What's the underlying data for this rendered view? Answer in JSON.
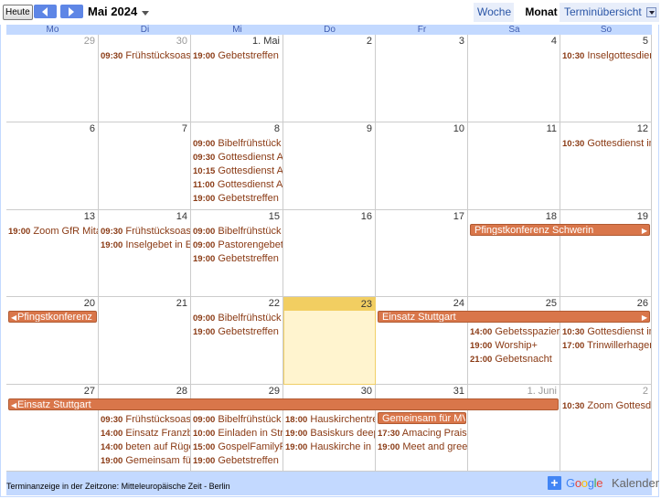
{
  "toolbar": {
    "today_label": "Heute",
    "month_title": "Mai 2024",
    "tabs": {
      "week": "Woche",
      "month": "Monat",
      "agenda": "Terminübersicht"
    }
  },
  "day_names": [
    "Mo",
    "Di",
    "Mi",
    "Do",
    "Fr",
    "Sa",
    "So"
  ],
  "weeks": [
    {
      "days": [
        {
          "date": "29",
          "other": true
        },
        {
          "date": "30",
          "other": true,
          "events": [
            {
              "time": "09:30",
              "title": "Frühstücksoase"
            }
          ]
        },
        {
          "date": "1. Mai",
          "events": [
            {
              "time": "19:00",
              "title": "Gebetstreffen"
            }
          ]
        },
        {
          "date": "2"
        },
        {
          "date": "3"
        },
        {
          "date": "4"
        },
        {
          "date": "5",
          "events": [
            {
              "time": "10:30",
              "title": "Inselgottesdienst"
            }
          ]
        }
      ]
    },
    {
      "days": [
        {
          "date": "6"
        },
        {
          "date": "7"
        },
        {
          "date": "8",
          "events": [
            {
              "time": "09:00",
              "title": "Bibelfrühstück"
            },
            {
              "time": "09:30",
              "title": "Gottesdienst A"
            },
            {
              "time": "10:15",
              "title": "Gottesdienst A"
            },
            {
              "time": "11:00",
              "title": "Gottesdienst A"
            },
            {
              "time": "19:00",
              "title": "Gebetstreffen"
            }
          ]
        },
        {
          "date": "9"
        },
        {
          "date": "10"
        },
        {
          "date": "11"
        },
        {
          "date": "12",
          "events": [
            {
              "time": "10:30",
              "title": "Gottesdienst im"
            }
          ]
        }
      ]
    },
    {
      "days": [
        {
          "date": "13",
          "events": [
            {
              "time": "19:00",
              "title": "Zoom GfR Mitarbeiter"
            }
          ]
        },
        {
          "date": "14",
          "events": [
            {
              "time": "09:30",
              "title": "Frühstücksoase"
            },
            {
              "time": "19:00",
              "title": "Inselgebet in E"
            }
          ]
        },
        {
          "date": "15",
          "events": [
            {
              "time": "09:00",
              "title": "Bibelfrühstück"
            },
            {
              "time": "09:00",
              "title": "Pastorengebet"
            },
            {
              "time": "19:00",
              "title": "Gebetstreffen"
            }
          ]
        },
        {
          "date": "16"
        },
        {
          "date": "17"
        },
        {
          "date": "18"
        },
        {
          "date": "19"
        }
      ],
      "bars": [
        {
          "title": "Pfingstkonferenz Schwerin",
          "start": 5,
          "span": 2,
          "cont_right": true
        }
      ]
    },
    {
      "days": [
        {
          "date": "20"
        },
        {
          "date": "21"
        },
        {
          "date": "22",
          "events": [
            {
              "time": "09:00",
              "title": "Bibelfrühstück"
            },
            {
              "time": "19:00",
              "title": "Gebetstreffen"
            }
          ]
        },
        {
          "date": "23",
          "today": true
        },
        {
          "date": "24"
        },
        {
          "date": "25",
          "events": [
            {
              "time": "14:00",
              "title": "Gebetsspaziergang"
            },
            {
              "time": "19:00",
              "title": "Worship+"
            },
            {
              "time": "21:00",
              "title": "Gebetsnacht"
            }
          ]
        },
        {
          "date": "26",
          "events": [
            {
              "time": "10:30",
              "title": "Gottesdienst im"
            },
            {
              "time": "17:00",
              "title": "Trinwillerhagen"
            }
          ]
        }
      ],
      "bars": [
        {
          "title": "Pfingstkonferenz",
          "start": 0,
          "span": 1,
          "cont_left": true
        },
        {
          "title": "Einsatz Stuttgart",
          "start": 4,
          "span": 3,
          "cont_right": true
        }
      ]
    },
    {
      "days": [
        {
          "date": "27"
        },
        {
          "date": "28",
          "events": [
            {
              "time": "09:30",
              "title": "Frühstücksoase"
            },
            {
              "time": "14:00",
              "title": "Einsatz Franzburg"
            },
            {
              "time": "14:00",
              "title": "beten auf Rügen"
            },
            {
              "time": "19:00",
              "title": "Gemeinsam für"
            }
          ]
        },
        {
          "date": "29",
          "events": [
            {
              "time": "09:00",
              "title": "Bibelfrühstück"
            },
            {
              "time": "10:00",
              "title": "Einladen in Str"
            },
            {
              "time": "15:00",
              "title": "GospelFamilyFest"
            },
            {
              "time": "19:00",
              "title": "Gebetstreffen"
            }
          ]
        },
        {
          "date": "30",
          "events": [
            {
              "time": "18:00",
              "title": "Hauskirchentreffen"
            },
            {
              "time": "19:00",
              "title": "Basiskurs deep"
            },
            {
              "time": "19:00",
              "title": "Hauskirche in"
            }
          ]
        },
        {
          "date": "31",
          "events": [
            {
              "time": "17:30",
              "title": "Amacing Praise"
            },
            {
              "time": "19:00",
              "title": "Meet and greet"
            }
          ]
        },
        {
          "date": "1. Juni",
          "other": true
        },
        {
          "date": "2",
          "other": true,
          "events": [
            {
              "time": "10:30",
              "title": "Zoom Gottesdienst"
            }
          ]
        }
      ],
      "bars": [
        {
          "title": "Einsatz Stuttgart",
          "start": 0,
          "span": 6,
          "cont_left": true
        },
        {
          "title": "Gemeinsam für MV",
          "start": 4,
          "span": 1,
          "row": 1
        }
      ]
    }
  ],
  "footer": {
    "timezone": "Terminanzeige in der Zeitzone: Mitteleuropäische Zeit - Berlin",
    "brand_g": "Google",
    "brand_k": "Kalender"
  },
  "colors": {
    "event_text": "#8a3a14",
    "bar": "#d9764a",
    "header_bg": "#c3d9ff",
    "today": "#fff4cf"
  }
}
